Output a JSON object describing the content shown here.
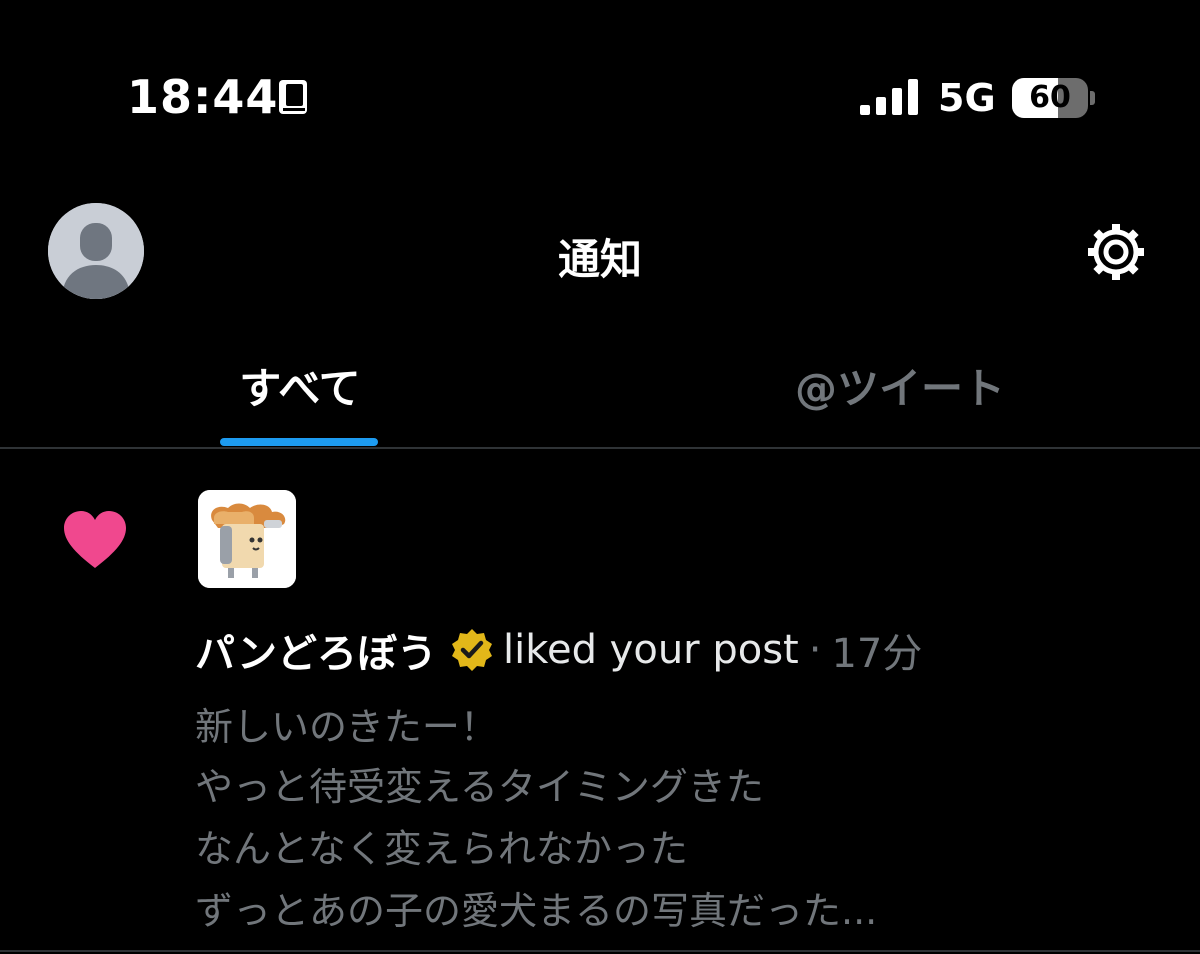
{
  "status_bar": {
    "time": "18:44",
    "network": "5G",
    "battery": {
      "label": "60",
      "level": 0.6
    },
    "icons": {
      "book": "book-icon",
      "signal": "signal-bars-icon"
    }
  },
  "header": {
    "title": "通知",
    "icons": {
      "avatar": "avatar-icon",
      "settings": "gear-icon"
    }
  },
  "tabs": [
    {
      "label": "すべて",
      "active": true
    },
    {
      "label": "@ツイート",
      "active": false
    }
  ],
  "notification": {
    "icon": "heart-icon",
    "actor_name": "パンどろぼう",
    "verified_icon": "verified-badge-icon",
    "action": "liked your post",
    "separator": "·",
    "elapsed": "17分",
    "post_lines": [
      "新しいのきたー！",
      "やっと待受変えるタイミングきた",
      "なんとなく変えられなかった",
      "ずっとあの子の愛犬まるの写真だった..."
    ]
  },
  "colors": {
    "background": "#000000",
    "accent": "#1d9bf0",
    "like": "#f91880",
    "verified": "#e2b719",
    "muted": "#71767b"
  }
}
